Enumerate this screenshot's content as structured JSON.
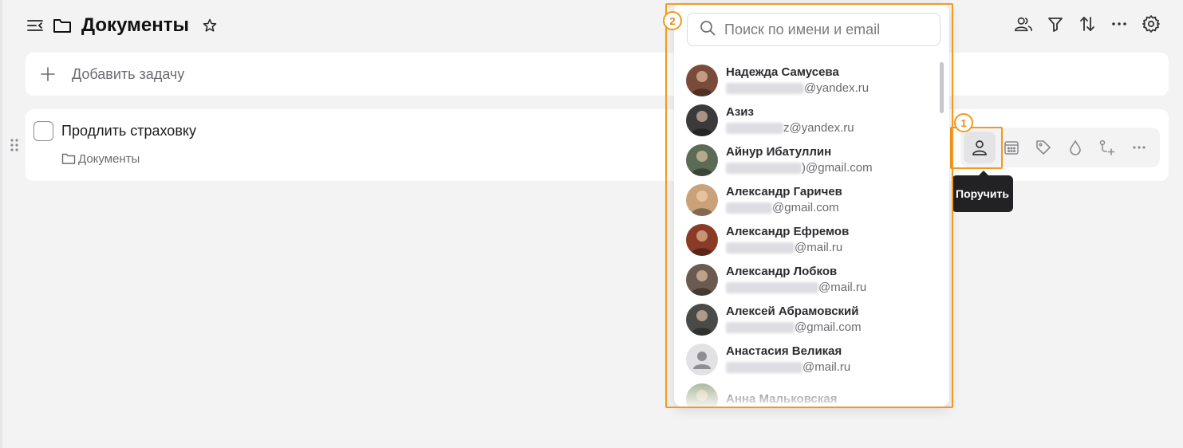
{
  "header": {
    "title": "Документы",
    "menu_icon": "collapse-menu-icon",
    "folder_icon": "folder-icon",
    "star_icon": "star-outline-icon"
  },
  "toolbar": {
    "icons": [
      "members-icon",
      "filter-icon",
      "sort-icon",
      "more-horizontal-icon",
      "settings-gear-icon"
    ]
  },
  "add_task": {
    "label": "Добавить задачу"
  },
  "task": {
    "title": "Продлить страховку",
    "folder": "Документы",
    "actions": [
      "assign-user-icon",
      "calendar-icon",
      "tag-icon",
      "priority-drop-icon",
      "subtask-add-icon",
      "more-horizontal-icon"
    ]
  },
  "tooltip": {
    "text": "Поручить"
  },
  "annotations": {
    "badge1": "1",
    "badge2": "2",
    "color": "#f29a1f"
  },
  "assign_dropdown": {
    "search_placeholder": "Поиск по имени и email",
    "users": [
      {
        "name": "Надежда Самусева",
        "email": "@yandex.ru",
        "avatar_color": "#7a4b3a"
      },
      {
        "name": "Азиз",
        "email": "z@yandex.ru",
        "avatar_color": "#3a3a3a"
      },
      {
        "name": "Айнур Ибатуллин",
        "email": ")@gmail.com",
        "avatar_color": "#5b6b55"
      },
      {
        "name": "Александр Гаричев",
        "email": "@gmail.com",
        "avatar_color": "#c9a27a"
      },
      {
        "name": "Александр Ефремов",
        "email": "@mail.ru",
        "avatar_color": "#8a3b25"
      },
      {
        "name": "Александр Лобков",
        "email": "@mail.ru",
        "avatar_color": "#6a5a4f"
      },
      {
        "name": "Алексей Абрамовский",
        "email": "@gmail.com",
        "avatar_color": "#4a4a48"
      },
      {
        "name": "Анастасия Великая",
        "email": "@mail.ru",
        "avatar_color": "#e2e2e4"
      },
      {
        "name": "Анна Мальковская",
        "email": "",
        "avatar_color": "#8fa07a"
      }
    ]
  }
}
